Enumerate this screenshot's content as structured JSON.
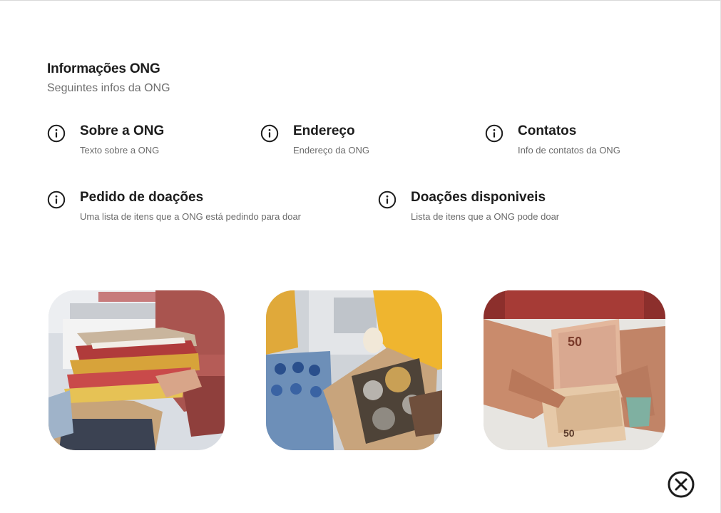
{
  "header": {
    "title": "Informações ONG",
    "subtitle": "Seguintes infos da ONG"
  },
  "info_items": [
    {
      "icon": "info-icon",
      "title": "Sobre a ONG",
      "desc": "Texto sobre a ONG"
    },
    {
      "icon": "info-icon",
      "title": "Endereço",
      "desc": "Endereço da ONG"
    },
    {
      "icon": "info-icon",
      "title": "Contatos",
      "desc": "Info de contatos da ONG"
    },
    {
      "icon": "info-icon",
      "title": "Pedido de doações",
      "desc": "Uma lista de itens que a ONG está pedindo para doar"
    },
    {
      "icon": "info-icon",
      "title": "Doações disponiveis",
      "desc": "Lista de itens que a ONG pode doar"
    }
  ],
  "photos": [
    {
      "subject": "clothes-donation-photo"
    },
    {
      "subject": "food-donation-photo"
    },
    {
      "subject": "money-donation-photo"
    }
  ],
  "close_icon": "close-circle-icon"
}
